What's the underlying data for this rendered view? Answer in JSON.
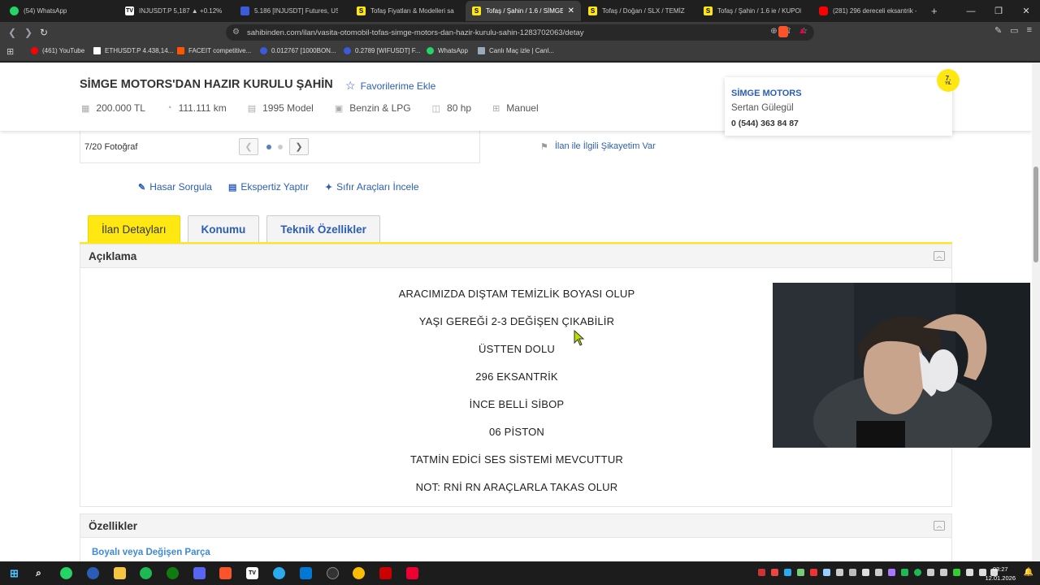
{
  "browser": {
    "tabs": [
      {
        "title": "(54) WhatsApp",
        "fav_color": "#25d366",
        "fav_icon": "whatsapp-icon"
      },
      {
        "title": "INJUSDT.P 5,187 ▲ +0.12% Sq",
        "fav_color": "#ffffff",
        "fav_icon": "tradingview-icon"
      },
      {
        "title": "5.186 [INJUSDT] Futures, USDT",
        "fav_color": "#3b5bdb",
        "fav_icon": "binance-icon"
      },
      {
        "title": "Tofaş Fiyatları & Modelleri sah",
        "fav_color": "#ffe812",
        "fav_icon": "sahibinden-icon"
      },
      {
        "title": "Tofaş / Şahin / 1.6 / SİMGE",
        "fav_color": "#ffe812",
        "fav_icon": "sahibinden-icon",
        "active": true
      },
      {
        "title": "Tofaş / Doğan / SLX / TEMİZ D",
        "fav_color": "#ffe812",
        "fav_icon": "sahibinden-icon"
      },
      {
        "title": "Tofaş / Şahin / 1.6 ie / KUPON",
        "fav_color": "#ffe812",
        "fav_icon": "sahibinden-icon"
      },
      {
        "title": "(281) 296 dereceli eksantrik - Y",
        "fav_color": "#ff0000",
        "fav_icon": "youtube-icon"
      }
    ],
    "new_tab": "+",
    "url": "sahibinden.com/ilan/vasita-otomobil-tofas-simge-motors-dan-hazir-kurulu-sahin-1283702063/detay",
    "bookmarks": [
      {
        "label": "(461) YouTube",
        "color": "#ff0000"
      },
      {
        "label": "ETHUSDT.P 4.438,14...",
        "color": "#ffffff"
      },
      {
        "label": "FACEIT competitive...",
        "color": "#ff5500"
      },
      {
        "label": "0.012767 [1000BON...",
        "color": "#3b5bdb"
      },
      {
        "label": "0.2789 [WIFUSDT] F...",
        "color": "#3b5bdb"
      },
      {
        "label": "WhatsApp",
        "color": "#25d366"
      },
      {
        "label": "Canlı Maç izle | Canl...",
        "color": "#9ab"
      }
    ]
  },
  "listing": {
    "title": "SİMGE MOTORS'DAN HAZIR KURULU ŞAHİN",
    "favorite_label": "Favorilerime Ekle",
    "specs": [
      {
        "icon": "price-icon",
        "glyph": "▦",
        "text": "200.000 TL"
      },
      {
        "icon": "speedometer-icon",
        "glyph": "◔",
        "text": "111.111 km"
      },
      {
        "icon": "calendar-icon",
        "glyph": "▤",
        "text": "1995 Model"
      },
      {
        "icon": "fuel-icon",
        "glyph": "▣",
        "text": "Benzin & LPG"
      },
      {
        "icon": "engine-icon",
        "glyph": "◫",
        "text": "80 hp"
      },
      {
        "icon": "gearbox-icon",
        "glyph": "⊞",
        "text": "Manuel"
      }
    ],
    "photo_count": "7/20 Fotoğraf",
    "complaint_label": "İlan ile İlgili Şikayetim Var",
    "actions": [
      {
        "icon": "wrench-icon",
        "glyph": "🔧",
        "label": "Hasar Sorgula"
      },
      {
        "icon": "report-icon",
        "glyph": "▤",
        "label": "Ekspertiz Yaptır"
      },
      {
        "icon": "pin-icon",
        "glyph": "✦",
        "label": "Sıfır Araçları İncele"
      }
    ],
    "tabs": [
      "İlan Detayları",
      "Konumu",
      "Teknik Özellikler"
    ],
    "description_title": "Açıklama",
    "description_lines": [
      "ARACIMIZDA DIŞTAM TEMİZLİK BOYASI OLUP",
      "YAŞI GEREĞİ 2-3 DEĞİŞEN ÇIKABİLİR",
      "ÜSTTEN DOLU",
      "296 EKSANTRİK",
      "İNCE BELLİ SİBOP",
      "06 PİSTON",
      "TATMİN EDİCİ SES SİSTEMİ MEVCUTTUR",
      "NOT: RNİ RN ARAÇLARLA TAKAS OLUR"
    ],
    "features_title": "Özellikler",
    "features_sub": "Boyalı veya Değişen Parça"
  },
  "seller": {
    "store": "SİMGE MOTORS",
    "person": "Sertan Gülegül",
    "phone": "0 (544) 363 84 87",
    "badge_num": "7.",
    "badge_unit": "YIL"
  },
  "taskbar": {
    "time": "03:27",
    "date": "12.01.2026"
  },
  "colors": {
    "accent_yellow": "#ffe812",
    "link_blue": "#2b5db7"
  }
}
